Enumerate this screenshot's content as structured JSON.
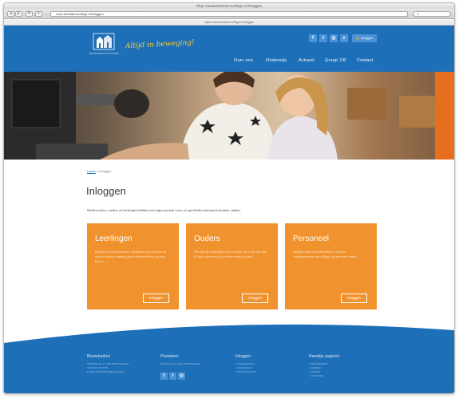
{
  "browser": {
    "window_title": "https://www.dewilderscollege.nl/inloggen",
    "address": "  www.dewilderscollege.nl/inloggen",
    "subbar_url": "https://www.dewilderscollege.nl/inloggen",
    "back": "◂",
    "forward": "▸"
  },
  "header": {
    "logo_text": "DE WILDERS COLLEGE",
    "slogan": "Altijd in beweging!",
    "login_label": "Inloggen",
    "social": [
      "f",
      "t",
      "◎",
      "⌕"
    ],
    "menu": [
      "Over ons",
      "Onderwijs",
      "Actueel",
      "Groep 7/8",
      "Contact"
    ]
  },
  "breadcrumb": {
    "home": "Home",
    "separator": "»",
    "current": "Inloggen"
  },
  "page": {
    "title": "Inloggen",
    "intro": "Medewerkers, ouders en leerlingen hebben een eigen portaal waar zij specifieke informatie kunnen vinden."
  },
  "cards": [
    {
      "title": "Leerlingen",
      "text": "Bekijk je actuele lesrooster, resultaten van je toetsen en nieuws zodat je vandaag goed voorbereid bent op jouw lessen.",
      "button": "Inloggen"
    },
    {
      "title": "Ouders",
      "text": "Wat zijn de vorderingen van uw kind, hoe is het met zijn of haar cijfers en wat is er deze week te doen?",
      "button": "Inloggen"
    },
    {
      "title": "Personeel",
      "text": "Bekijk actuele schoolinformatie, roosters, contactgegevens van collega's en personele zaken.",
      "button": "Inloggen"
    }
  ],
  "footer": {
    "columns": [
      {
        "heading": "Bezoekadres",
        "lines": [
          "Wildersstraat 1, 1234 AB Plaatsnaam",
          "Tel. 0123 45 67 89",
          "E-mail: info@dewilderscollege.nl"
        ]
      },
      {
        "heading": "Postadres",
        "lines": [
          "Postbus 1234, 1234 AB Plaatsnaam"
        ]
      },
      {
        "heading": "Inloggen",
        "lines": [
          "› Leerlingportaal",
          "› Ouderportaal",
          "› Personeelportaal"
        ]
      },
      {
        "heading": "Handige pagina's",
        "lines": [
          "› Schoolkalender",
          "› Lestijden",
          "› Vakantie",
          "› Downloads"
        ]
      }
    ],
    "social": [
      "f",
      "t",
      "◎"
    ]
  },
  "colors": {
    "brand_blue": "#1d6fb8",
    "card_orange": "#f0932e",
    "slogan_yellow": "#f7d040"
  }
}
